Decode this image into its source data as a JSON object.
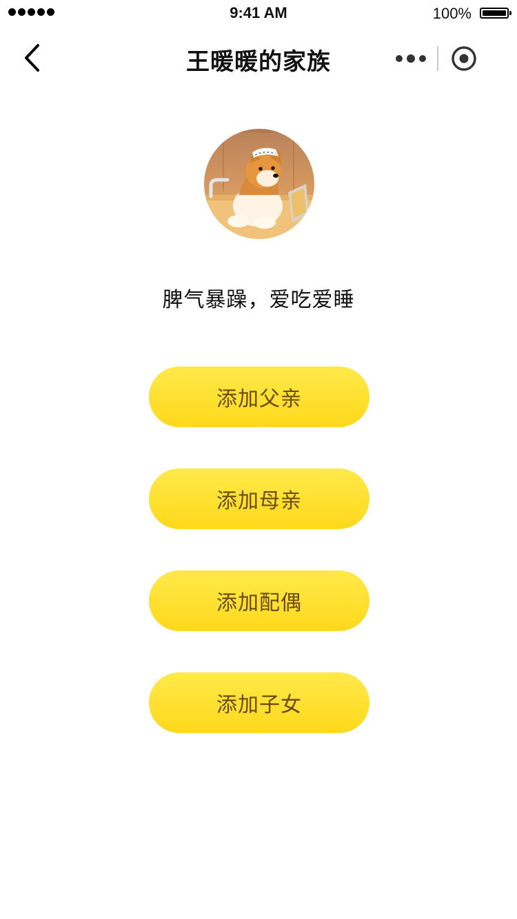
{
  "status_bar": {
    "time": "9:41 AM",
    "battery": "100%"
  },
  "nav": {
    "title": "王暖暖的家族",
    "back_icon": "chevron-left-icon",
    "more_icon": "more-dots-icon",
    "close_icon": "circle-target-icon"
  },
  "profile": {
    "avatar_icon": "dog-avatar",
    "bio": "脾气暴躁，爱吃爱睡"
  },
  "actions": [
    {
      "label": "添加父亲"
    },
    {
      "label": "添加母亲"
    },
    {
      "label": "添加配偶"
    },
    {
      "label": "添加子女"
    }
  ],
  "colors": {
    "button_top": "#ffe94a",
    "button_bottom": "#ffd81a",
    "button_text": "#6a4a0a"
  }
}
